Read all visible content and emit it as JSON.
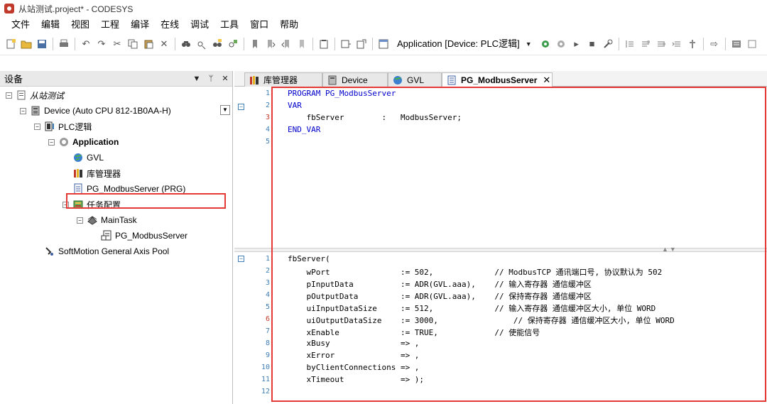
{
  "window": {
    "title": "从站测试.project* - CODESYS"
  },
  "menu": [
    "文件",
    "编辑",
    "视图",
    "工程",
    "编译",
    "在线",
    "调试",
    "工具",
    "窗口",
    "帮助"
  ],
  "toolbar": {
    "application_combo": "Application [Device: PLC逻辑]"
  },
  "devices_panel": {
    "title": "设备",
    "tree": [
      {
        "label": "从站测试",
        "icon": "project-icon"
      },
      {
        "label": "Device (Auto CPU 812-1B0AA-H)",
        "icon": "device-icon"
      },
      {
        "label": "PLC逻辑",
        "icon": "plc-logic-icon"
      },
      {
        "label": "Application",
        "icon": "application-gear-icon"
      },
      {
        "label": "GVL",
        "icon": "globe-icon"
      },
      {
        "label": "库管理器",
        "icon": "library-icon"
      },
      {
        "label": "PG_ModbusServer (PRG)",
        "icon": "program-document-icon"
      },
      {
        "label": "任务配置",
        "icon": "task-config-icon"
      },
      {
        "label": "MainTask",
        "icon": "task-icon"
      },
      {
        "label": "PG_ModbusServer",
        "icon": "program-call-icon"
      },
      {
        "label": "SoftMotion General Axis Pool",
        "icon": "axis-pool-icon"
      }
    ]
  },
  "tabs": [
    {
      "label": "库管理器",
      "icon": "library-icon"
    },
    {
      "label": "Device",
      "icon": "device-icon"
    },
    {
      "label": "GVL",
      "icon": "globe-icon"
    },
    {
      "label": "PG_ModbusServer",
      "icon": "program-document-icon",
      "active": true
    }
  ],
  "declaration": {
    "line_numbers": [
      "1",
      "2",
      "3",
      "4",
      "5"
    ],
    "lines": [
      "PROGRAM PG_ModbusServer",
      "VAR",
      "    fbServer        :   ModbusServer;",
      "END_VAR",
      ""
    ]
  },
  "implementation": {
    "line_numbers": [
      "1",
      "2",
      "3",
      "4",
      "5",
      "6",
      "7",
      "8",
      "9",
      "10",
      "11",
      "12"
    ],
    "lines": [
      "fbServer(",
      "    wPort               := 502,             // ModbusTCP 通讯端口号, 协议默认为 502",
      "    pInputData          := ADR(GVL.aaa),    // 输入寄存器 通信缓冲区",
      "    pOutputData         := ADR(GVL.aaa),    // 保持寄存器 通信缓冲区",
      "    uiInputDataSize     := 512,             // 输入寄存器 通信缓冲区大小, 单位 WORD",
      "    uiOutputDataSize    := 3000,                // 保持寄存器 通信缓冲区大小, 单位 WORD",
      "    xEnable             := TRUE,            // 使能信号",
      "    xBusy               => ,",
      "    xError              => ,",
      "    byClientConnections => ,",
      "    xTimeout            => );",
      ""
    ]
  }
}
